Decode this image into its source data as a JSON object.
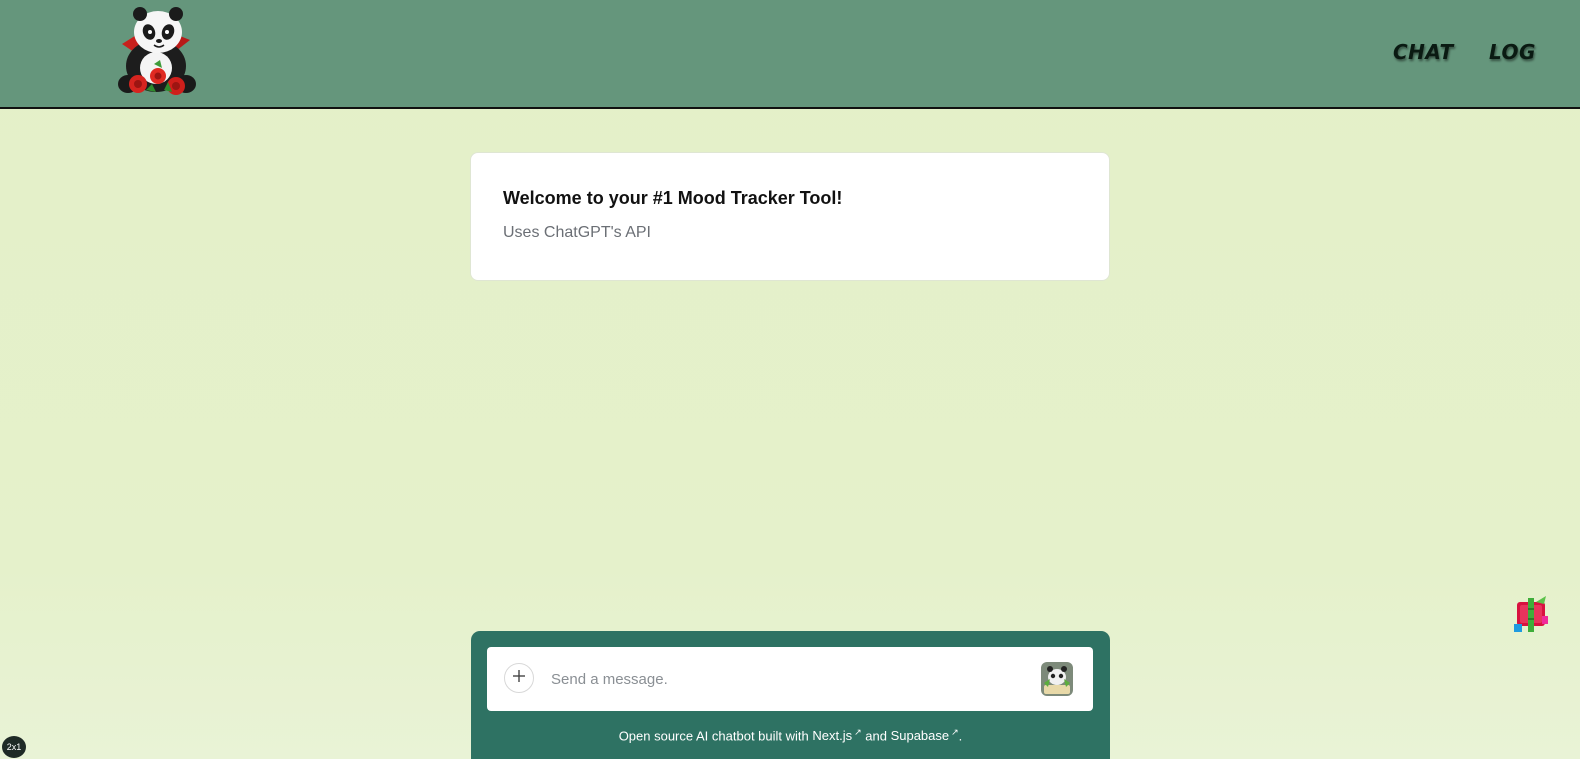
{
  "header": {
    "nav": [
      {
        "label": "CHAT"
      },
      {
        "label": "LOG"
      }
    ],
    "logo_icon": "panda-with-roses-logo"
  },
  "welcome": {
    "title": "Welcome to your #1 Mood Tracker Tool!",
    "subtitle": "Uses ChatGPT's API"
  },
  "composer": {
    "placeholder": "Send a message.",
    "value": "",
    "add_icon": "plus-icon",
    "send_icon": "panda-send-icon",
    "footer": {
      "prefix": "Open source AI chatbot built with ",
      "link1": "Next.js",
      "middle": " and ",
      "link2": "Supabase",
      "suffix": ".",
      "ext_glyph": "↗"
    }
  },
  "side_widget_icon": "bamboo-gift-icon",
  "zoom_badge": "2x1",
  "colors": {
    "header_bg": "#65967c",
    "page_bg": "#e4f0c8",
    "composer_bg": "#2e7263",
    "card_bg": "#ffffff"
  }
}
